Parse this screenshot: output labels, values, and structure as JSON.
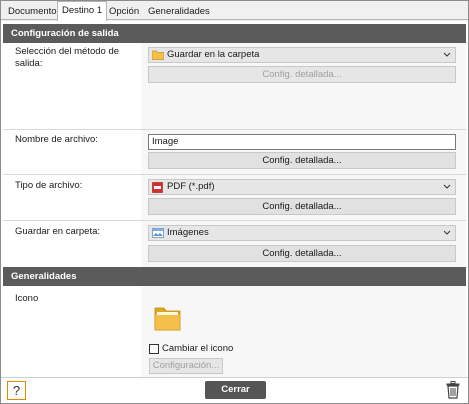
{
  "tabs": [
    {
      "label": "Documento"
    },
    {
      "label": "Destino 1"
    },
    {
      "label": "Opción"
    },
    {
      "label": "Generalidades"
    }
  ],
  "section_output": {
    "title": "Configuración de salida",
    "method": {
      "label": "Selección del método de salida:",
      "value": "Guardar en la carpeta",
      "button": "Config. detallada..."
    },
    "filename": {
      "label": "Nombre de archivo:",
      "value": "Image",
      "button": "Config. detallada..."
    },
    "filetype": {
      "label": "Tipo de archivo:",
      "value": "PDF (*.pdf)",
      "button": "Config. detallada..."
    },
    "save_folder": {
      "label": "Guardar en carpeta:",
      "value": "Imágenes",
      "button": "Config. detallada..."
    }
  },
  "section_general": {
    "title": "Generalidades",
    "icon_label": "Icono",
    "change_icon_label": "Cambiar el icono",
    "change_icon_checked": false,
    "config_button": "Configuración..."
  },
  "footer": {
    "help_label": "?",
    "close_label": "Cerrar"
  },
  "colors": {
    "section_header": "#5b5b5b",
    "help_border": "#e08a00",
    "close_button": "#555555",
    "folder": "#f5c04a",
    "pdf_icon": "#d32f2f"
  }
}
